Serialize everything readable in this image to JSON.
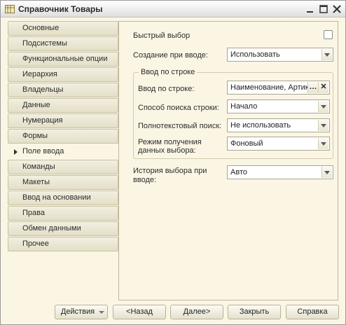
{
  "window": {
    "title": "Справочник Товары"
  },
  "tabs": [
    {
      "label": "Основные"
    },
    {
      "label": "Подсистемы"
    },
    {
      "label": "Функциональные опции"
    },
    {
      "label": "Иерархия"
    },
    {
      "label": "Владельцы"
    },
    {
      "label": "Данные"
    },
    {
      "label": "Нумерация"
    },
    {
      "label": "Формы"
    },
    {
      "label": "Поле ввода",
      "active": true
    },
    {
      "label": "Команды"
    },
    {
      "label": "Макеты"
    },
    {
      "label": "Ввод на основании"
    },
    {
      "label": "Права"
    },
    {
      "label": "Обмен данными"
    },
    {
      "label": "Прочее"
    }
  ],
  "panel": {
    "quick_choice_label": "Быстрый выбор",
    "quick_choice_checked": false,
    "create_on_input_label": "Создание при вводе:",
    "create_on_input_value": "Использовать",
    "group_title": "Ввод по строке",
    "input_by_string_label": "Ввод по строке:",
    "input_by_string_value": "Наименование, Артик",
    "search_mode_label": "Способ поиска строки:",
    "search_mode_value": "Начало",
    "fulltext_label": "Полнотекстовый поиск:",
    "fulltext_value": "Не использовать",
    "data_mode_label_line1": "Режим получения",
    "data_mode_label_line2": "данных выбора:",
    "data_mode_value": "Фоновый",
    "history_label_line1": "История выбора при",
    "history_label_line2": "вводе:",
    "history_value": "Авто"
  },
  "buttons": {
    "actions": "Действия",
    "back": "<Назад",
    "next": "Далее>",
    "close": "Закрыть",
    "help": "Справка"
  }
}
